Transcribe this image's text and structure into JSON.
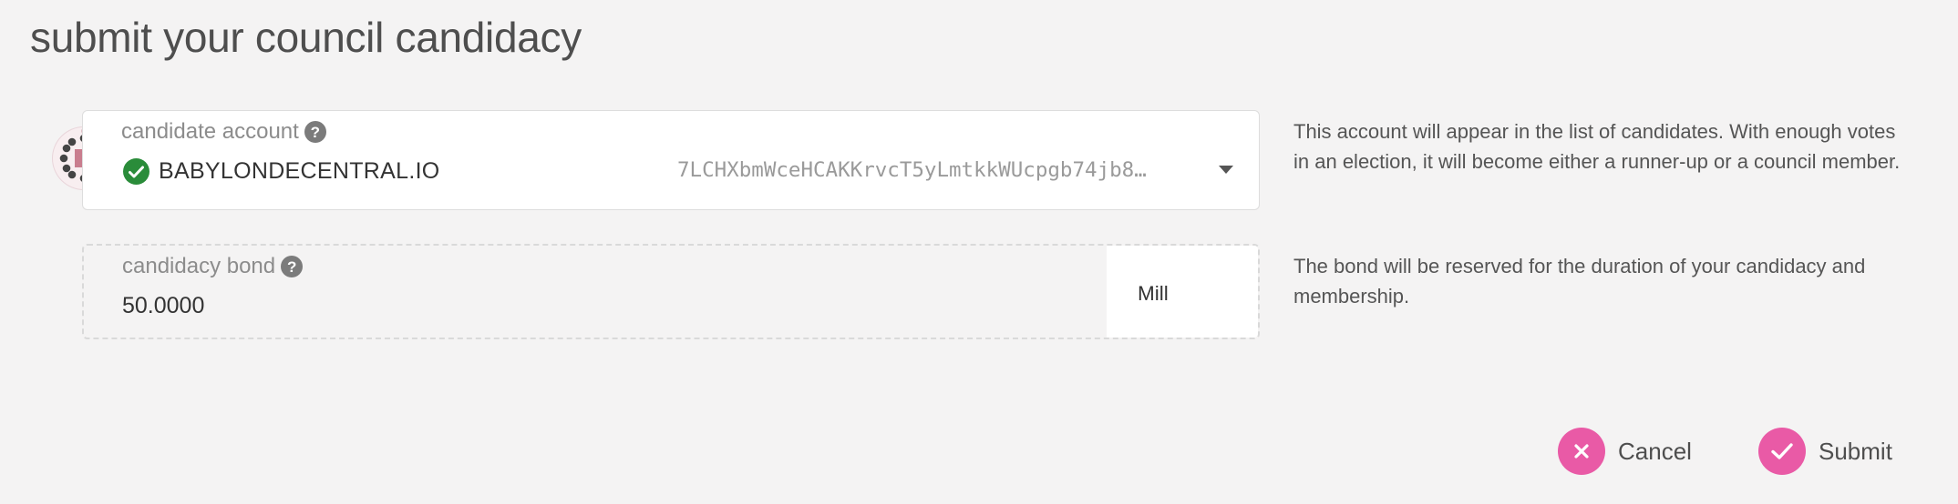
{
  "modal": {
    "title": "submit your council candidacy"
  },
  "account_field": {
    "label": "candidate account",
    "icon": "help-icon",
    "account_name": "BABYLONDECENTRAL.IO",
    "address": "7LCHXbmWceHCAKKrvcT5yLmtkkWUcpgb74jb8…",
    "verified_icon": "check-circle-icon",
    "help": "This account will appear in the list of candidates. With enough votes in an election, it will become either a runner-up or a council member."
  },
  "bond_field": {
    "label": "candidacy bond",
    "icon": "help-icon",
    "value": "50.0000",
    "unit": "Mill",
    "help": "The bond will be reserved for the duration of your candidacy and membership."
  },
  "actions": {
    "cancel_label": "Cancel",
    "submit_label": "Submit"
  },
  "colors": {
    "background": "#f4f3f3",
    "accent": "#e95aa6",
    "verified": "#2a8c3a",
    "avatar_primary": "#c97d8e",
    "avatar_dots": "#444444"
  }
}
